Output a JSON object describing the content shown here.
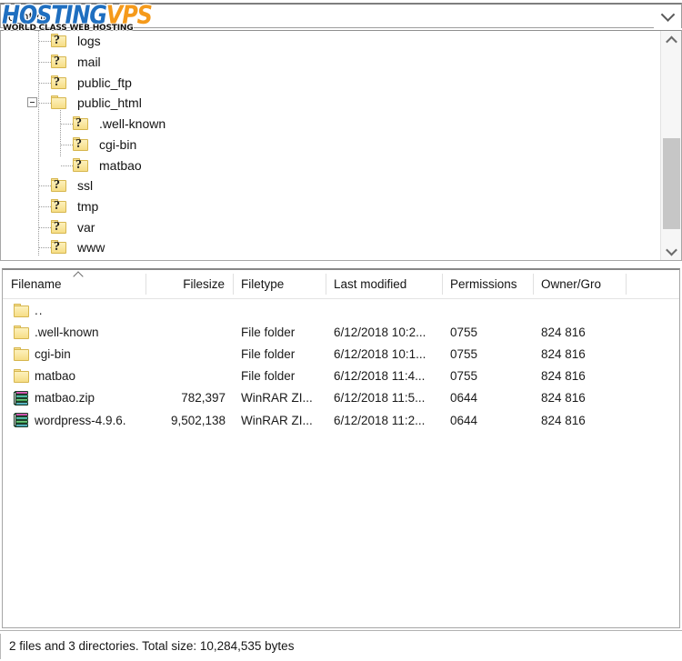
{
  "watermark": {
    "brand_part1": "HOSTING",
    "brand_part2": "VPS",
    "tagline": "WORLD CLASS WEB HOSTING",
    "color_part1": "#1f6fc0",
    "color_part2": "#f59a1b"
  },
  "path_combo": {
    "value": "c_html",
    "dropdown_icon": "chevron-down-icon"
  },
  "tree": {
    "items": [
      {
        "label": "logs",
        "indent": 0,
        "icon": "folder-unknown-icon",
        "expander": null
      },
      {
        "label": "mail",
        "indent": 0,
        "icon": "folder-unknown-icon",
        "expander": null
      },
      {
        "label": "public_ftp",
        "indent": 0,
        "icon": "folder-unknown-icon",
        "expander": null
      },
      {
        "label": "public_html",
        "indent": 0,
        "icon": "folder-icon",
        "expander": "minus"
      },
      {
        "label": ".well-known",
        "indent": 1,
        "icon": "folder-unknown-icon",
        "expander": null
      },
      {
        "label": "cgi-bin",
        "indent": 1,
        "icon": "folder-unknown-icon",
        "expander": null
      },
      {
        "label": "matbao",
        "indent": 1,
        "icon": "folder-unknown-icon",
        "expander": null
      },
      {
        "label": "ssl",
        "indent": 0,
        "icon": "folder-unknown-icon",
        "expander": null
      },
      {
        "label": "tmp",
        "indent": 0,
        "icon": "folder-unknown-icon",
        "expander": null
      },
      {
        "label": "var",
        "indent": 0,
        "icon": "folder-unknown-icon",
        "expander": null
      },
      {
        "label": "www",
        "indent": 0,
        "icon": "folder-unknown-icon",
        "expander": null
      }
    ],
    "scrollbar": {
      "up_icon": "chevron-up-icon",
      "down_icon": "chevron-down-icon"
    }
  },
  "file_list": {
    "columns": [
      {
        "label": "Filename",
        "align": "left"
      },
      {
        "label": "Filesize",
        "align": "right"
      },
      {
        "label": "Filetype",
        "align": "left"
      },
      {
        "label": "Last modified",
        "align": "left"
      },
      {
        "label": "Permissions",
        "align": "left"
      },
      {
        "label": "Owner/Gro",
        "align": "left"
      }
    ],
    "sort": {
      "column": "Filename",
      "direction": "ascending",
      "icon": "caret-up-icon"
    },
    "rows": [
      {
        "icon": "folder-icon",
        "filename": "..",
        "filesize": "",
        "filetype": "",
        "last_modified": "",
        "permissions": "",
        "owner_group": ""
      },
      {
        "icon": "folder-icon",
        "filename": ".well-known",
        "filesize": "",
        "filetype": "File folder",
        "last_modified": "6/12/2018 10:2...",
        "permissions": "0755",
        "owner_group": "824 816"
      },
      {
        "icon": "folder-icon",
        "filename": "cgi-bin",
        "filesize": "",
        "filetype": "File folder",
        "last_modified": "6/12/2018 10:1...",
        "permissions": "0755",
        "owner_group": "824 816"
      },
      {
        "icon": "folder-icon",
        "filename": "matbao",
        "filesize": "",
        "filetype": "File folder",
        "last_modified": "6/12/2018 11:4...",
        "permissions": "0755",
        "owner_group": "824 816"
      },
      {
        "icon": "archive-icon",
        "filename": "matbao.zip",
        "filesize": "782,397",
        "filetype": "WinRAR ZI...",
        "last_modified": "6/12/2018 11:5...",
        "permissions": "0644",
        "owner_group": "824 816"
      },
      {
        "icon": "archive-icon",
        "filename": "wordpress-4.9.6.",
        "filesize": "9,502,138",
        "filetype": "WinRAR ZI...",
        "last_modified": "6/12/2018 11:2...",
        "permissions": "0644",
        "owner_group": "824 816"
      }
    ]
  },
  "status_bar": {
    "text": "2 files and 3 directories. Total size: 10,284,535 bytes"
  }
}
